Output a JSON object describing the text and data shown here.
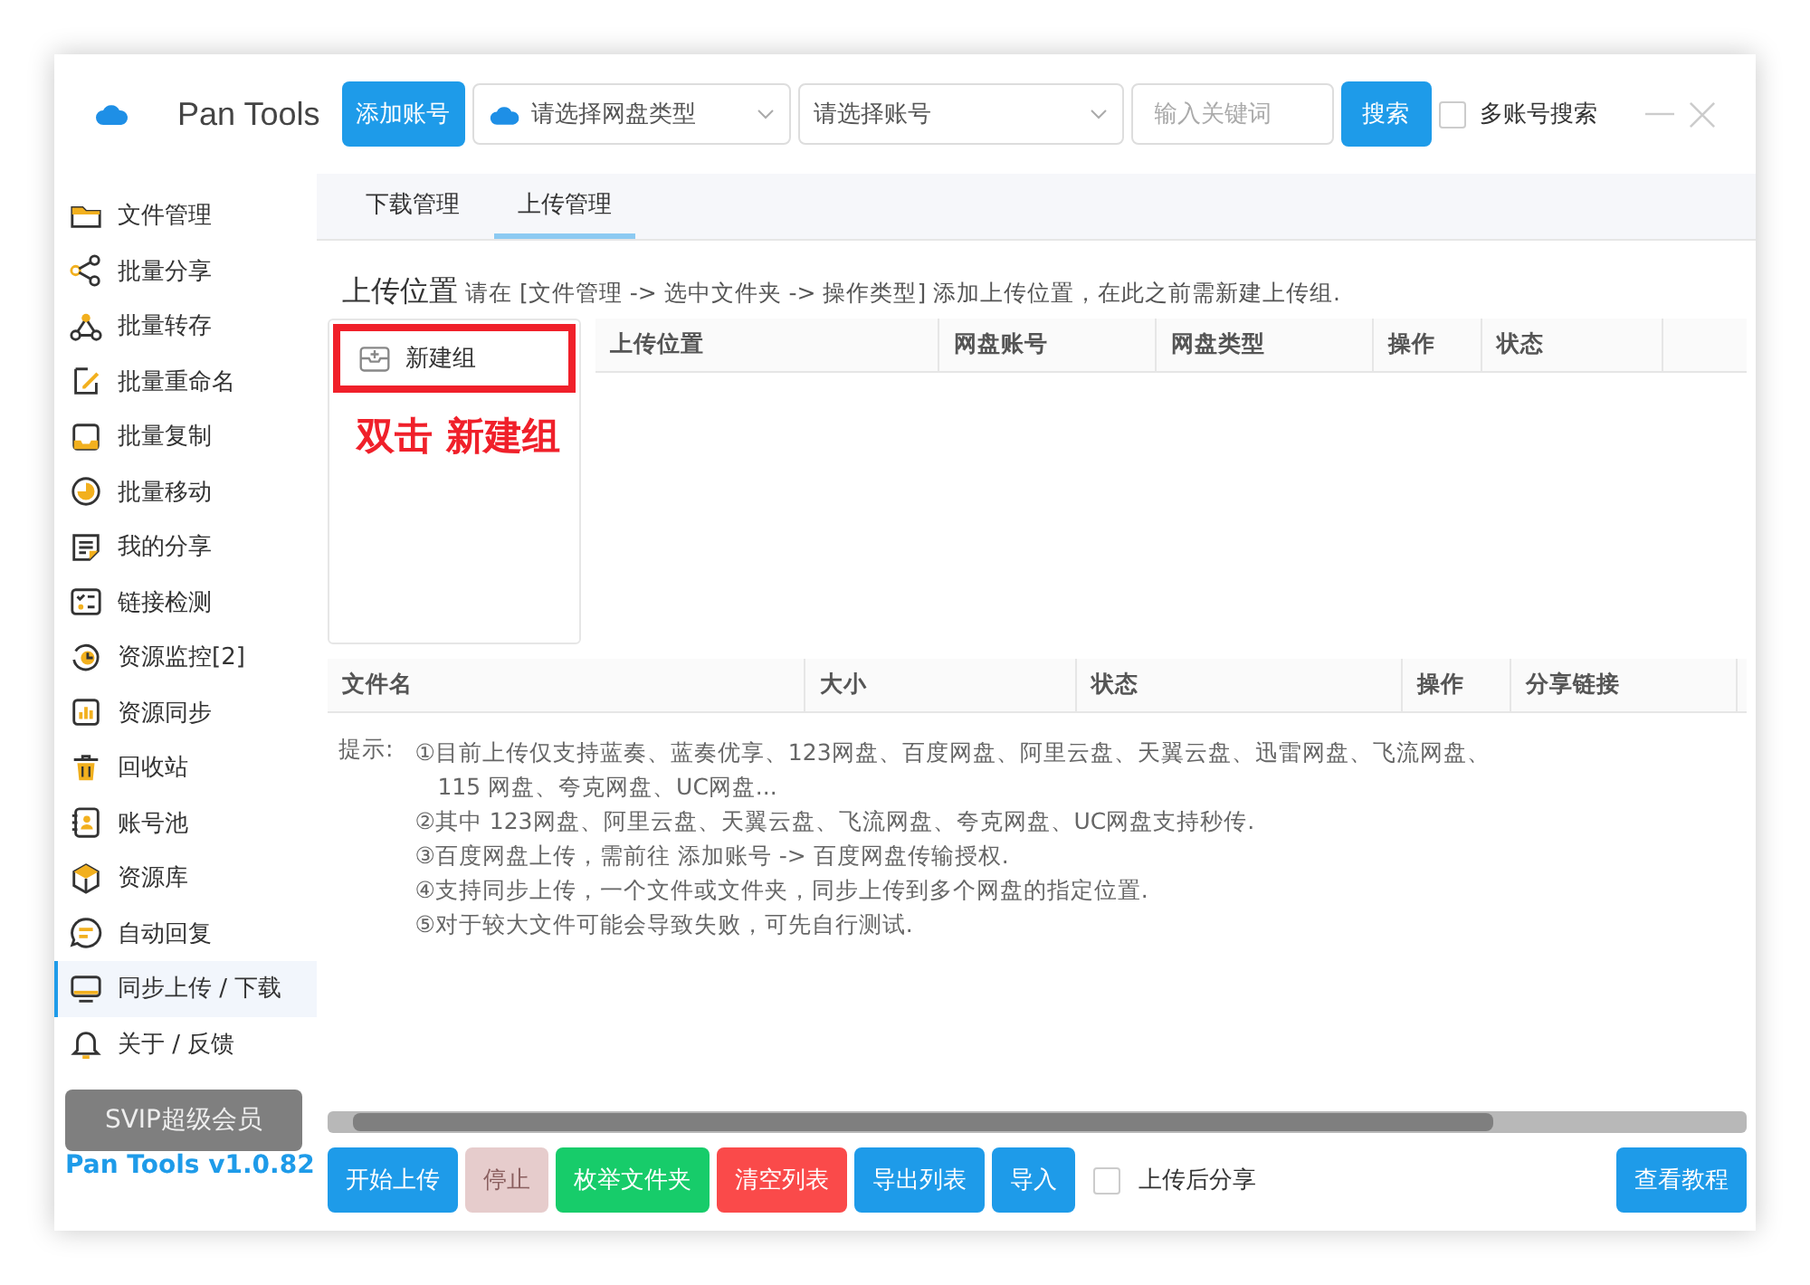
{
  "app": {
    "title": "Pan Tools",
    "add_account_button": "添加账号",
    "disk_type_select": {
      "placeholder": "请选择网盘类型"
    },
    "account_select": {
      "placeholder": "请选择账号"
    },
    "keyword_field": {
      "placeholder": "输入关键词"
    },
    "search_button": "搜索",
    "multi_account_search": {
      "label": "多账号搜索",
      "checked": false
    }
  },
  "sidebar": {
    "items": [
      {
        "label": "文件管理",
        "selected": false
      },
      {
        "label": "批量分享",
        "selected": false
      },
      {
        "label": "批量转存",
        "selected": false
      },
      {
        "label": "批量重命名",
        "selected": false
      },
      {
        "label": "批量复制",
        "selected": false
      },
      {
        "label": "批量移动",
        "selected": false
      },
      {
        "label": "我的分享",
        "selected": false
      },
      {
        "label": "链接检测",
        "selected": false
      },
      {
        "label": "资源监控[2]",
        "selected": false
      },
      {
        "label": "资源同步",
        "selected": false
      },
      {
        "label": "回收站",
        "selected": false
      },
      {
        "label": "账号池",
        "selected": false
      },
      {
        "label": "资源库",
        "selected": false
      },
      {
        "label": "自动回复",
        "selected": false
      },
      {
        "label": "同步上传 / 下载",
        "selected": true
      },
      {
        "label": "关于 / 反馈",
        "selected": false
      }
    ],
    "svip_button": "SVIP超级会员",
    "version": "Pan Tools v1.0.82"
  },
  "tabs": [
    {
      "label": "下载管理",
      "selected": false
    },
    {
      "label": "上传管理",
      "selected": true
    }
  ],
  "upload_location": {
    "title": "上传位置",
    "hint": "请在 [文件管理 -> 选中文件夹 -> 操作类型] 添加上传位置，在此之前需新建上传组.",
    "groups": [
      {
        "label": "新建组",
        "highlighted": true
      }
    ],
    "annotation": "双击 新建组",
    "columns": [
      "上传位置",
      "网盘账号",
      "网盘类型",
      "操作",
      "状态"
    ]
  },
  "file_table": {
    "columns": [
      "文件名",
      "大小",
      "状态",
      "操作",
      "分享链接"
    ]
  },
  "tips": {
    "label": "提示:",
    "items": [
      "①目前上传仅支持蓝奏、蓝奏优享、123网盘、百度网盘、阿里云盘、天翼云盘、迅雷网盘、飞流网盘、115 网盘、夸克网盘、UC网盘...",
      "②其中  123网盘、阿里云盘、天翼云盘、飞流网盘、夸克网盘、UC网盘支持秒传.",
      "③百度网盘上传，需前往  添加账号  ->  百度网盘传输授权.",
      "④支持同步上传，一个文件或文件夹，同步上传到多个网盘的指定位置.",
      "⑤对于较大文件可能会导致失败，可先自行测试."
    ]
  },
  "actions": [
    {
      "label": "开始上传",
      "color": "#1e9be9",
      "disabled": false
    },
    {
      "label": "停止",
      "disabled": true
    },
    {
      "label": "枚举文件夹",
      "color": "#17cc6a",
      "disabled": false
    },
    {
      "label": "清空列表",
      "color": "#fa4a4a",
      "disabled": false
    },
    {
      "label": "导出列表",
      "color": "#1e9be9",
      "disabled": false
    },
    {
      "label": "导入",
      "color": "#1e9be9",
      "disabled": false
    }
  ],
  "share_after_upload": {
    "label": "上传后分享",
    "checked": false
  },
  "tutorial_button": "查看教程"
}
